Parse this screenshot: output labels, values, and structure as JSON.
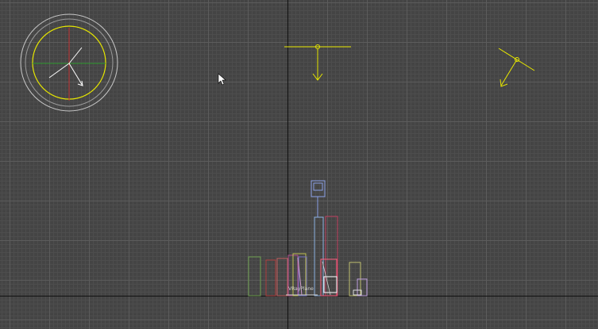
{
  "viewport": {
    "view_type": "wireframe-top",
    "grid_visible": true,
    "colors": {
      "background": "#444444",
      "grid_minor": "#4d4d4d",
      "grid_major": "#5c5c5c",
      "world_axis": "#111111",
      "light_gizmo": "#e6e600",
      "skylight_ring": "#c8c8c8",
      "camera": "#8aa0e6"
    }
  },
  "objects": {
    "selected_label": "VRayPlane"
  },
  "icons": [
    "vray-sun-icon",
    "target-direct-light-icon",
    "free-spot-light-icon",
    "camera-icon",
    "mouse-cursor-icon"
  ]
}
